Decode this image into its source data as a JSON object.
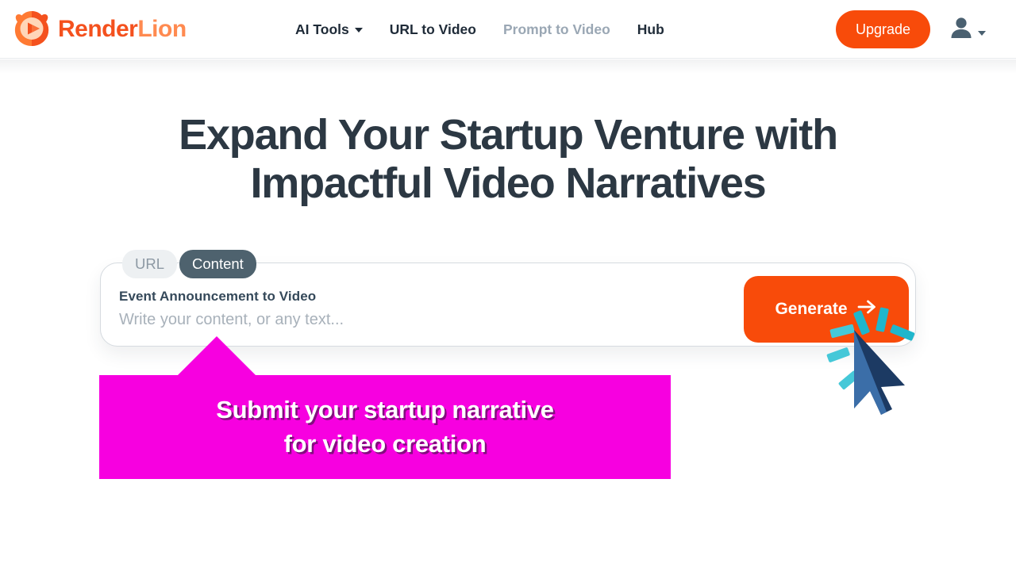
{
  "header": {
    "brand": {
      "part1": "Render",
      "part2": "Lion",
      "logo_icon": "lion-play-logo",
      "color_primary": "#f4511e",
      "color_secondary": "#ff8a50"
    },
    "nav": [
      {
        "label": "AI Tools",
        "has_caret": true,
        "state": "default"
      },
      {
        "label": "URL to Video",
        "has_caret": false,
        "state": "default"
      },
      {
        "label": "Prompt to Video",
        "has_caret": false,
        "state": "muted"
      },
      {
        "label": "Hub",
        "has_caret": false,
        "state": "default"
      }
    ],
    "upgrade_label": "Upgrade",
    "upgrade_color": "#f84b0a",
    "account_icon": "user-avatar-icon",
    "account_caret_icon": "chevron-down-icon"
  },
  "hero": {
    "title": "Expand Your Startup Venture with Impactful Video Narratives",
    "title_color": "#2c3843"
  },
  "input_card": {
    "tabs": [
      {
        "label": "URL",
        "active": false
      },
      {
        "label": "Content",
        "active": true
      }
    ],
    "tab_active_color": "#4e626e",
    "tab_inactive_color": "#edf0f2",
    "field_label": "Event Announcement to Video",
    "field_value": "",
    "placeholder": "Write your content, or any text...",
    "generate_label": "Generate",
    "generate_arrow_icon": "arrow-right-icon",
    "generate_color": "#f84b0a"
  },
  "callout": {
    "line1": "Submit your startup narrative",
    "line2": "for video creation",
    "background_color": "#f700e0",
    "text_color": "#ffffff"
  },
  "cursor": {
    "icon": "mouse-pointer-arrow",
    "click_burst_icon": "click-burst-rays",
    "burst_color": "#1fb6cc",
    "arrow_light": "#3b6ea8",
    "arrow_dark": "#1c3a63"
  }
}
